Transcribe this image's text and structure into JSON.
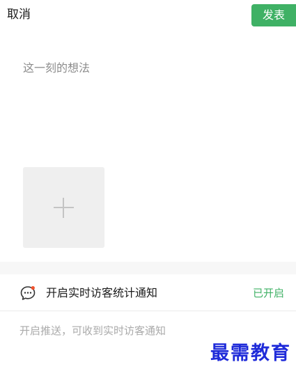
{
  "header": {
    "cancel_label": "取消",
    "post_label": "发表"
  },
  "compose": {
    "placeholder": "这一刻的想法"
  },
  "media": {
    "add_icon": "plus-icon"
  },
  "notification": {
    "icon": "chat-bubble-icon",
    "label": "开启实时访客统计通知",
    "status": "已开启",
    "hint": "开启推送，可收到实时访客通知"
  },
  "watermark": {
    "text": "最需教育"
  },
  "colors": {
    "accent": "#3fb165",
    "badge": "#f0522e",
    "placeholder_text": "#8c8c8c",
    "tile": "#efefef"
  }
}
